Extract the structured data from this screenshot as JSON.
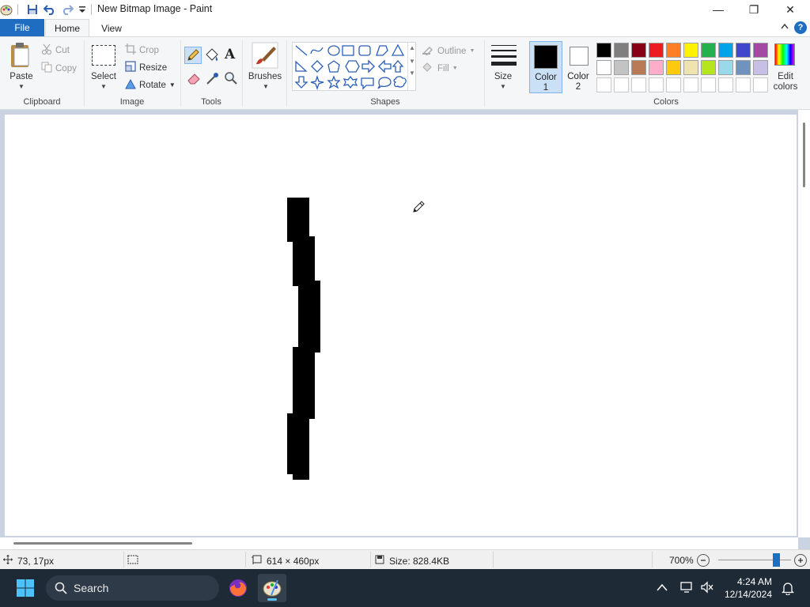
{
  "window": {
    "title": "New Bitmap Image - Paint",
    "minimize_glyph": "—",
    "restore_glyph": "❐",
    "close_glyph": "✕"
  },
  "quick_access": {
    "icons": [
      "paint-app-icon",
      "save-icon",
      "undo-icon",
      "redo-icon",
      "customize-dropdown-icon"
    ]
  },
  "tabs": {
    "file": "File",
    "home": "Home",
    "view": "View",
    "help": "?"
  },
  "clipboard": {
    "paste": "Paste",
    "cut": "Cut",
    "copy": "Copy",
    "group": "Clipboard"
  },
  "image": {
    "select": "Select",
    "crop": "Crop",
    "resize": "Resize",
    "rotate": "Rotate",
    "group": "Image"
  },
  "tools": {
    "group": "Tools",
    "items": [
      "pencil-icon",
      "fill-bucket-icon",
      "text-icon",
      "eraser-icon",
      "color-picker-icon",
      "magnifier-icon"
    ],
    "text_glyph": "A"
  },
  "brushes": {
    "label": "Brushes"
  },
  "shapes": {
    "outline": "Outline",
    "fill": "Fill",
    "group": "Shapes"
  },
  "size": {
    "label": "Size"
  },
  "colors": {
    "color1_line1": "Color",
    "color1_line2": "1",
    "color2_line1": "Color",
    "color2_line2": "2",
    "edit_line1": "Edit",
    "edit_line2": "colors",
    "group": "Colors",
    "color1_value": "#000000",
    "color2_value": "#ffffff",
    "palette_row1": [
      "#000000",
      "#7f7f7f",
      "#880015",
      "#ed1c24",
      "#ff7f27",
      "#fff200",
      "#22b14c",
      "#00a2e8",
      "#3f48cc",
      "#a349a4"
    ],
    "palette_row2": [
      "#ffffff",
      "#c3c3c3",
      "#b97a57",
      "#ffaec9",
      "#ffc90e",
      "#efe4b0",
      "#b5e61d",
      "#99d9ea",
      "#7092be",
      "#c8bfe7"
    ]
  },
  "status": {
    "cursor_pos": "73, 17px",
    "canvas_size": "614 × 460px",
    "file_size": "Size: 828.4KB",
    "zoom": "700%",
    "zoom_level_percent": 700
  },
  "taskbar": {
    "search": "Search",
    "time": "4:24 AM",
    "date": "12/14/2024"
  }
}
